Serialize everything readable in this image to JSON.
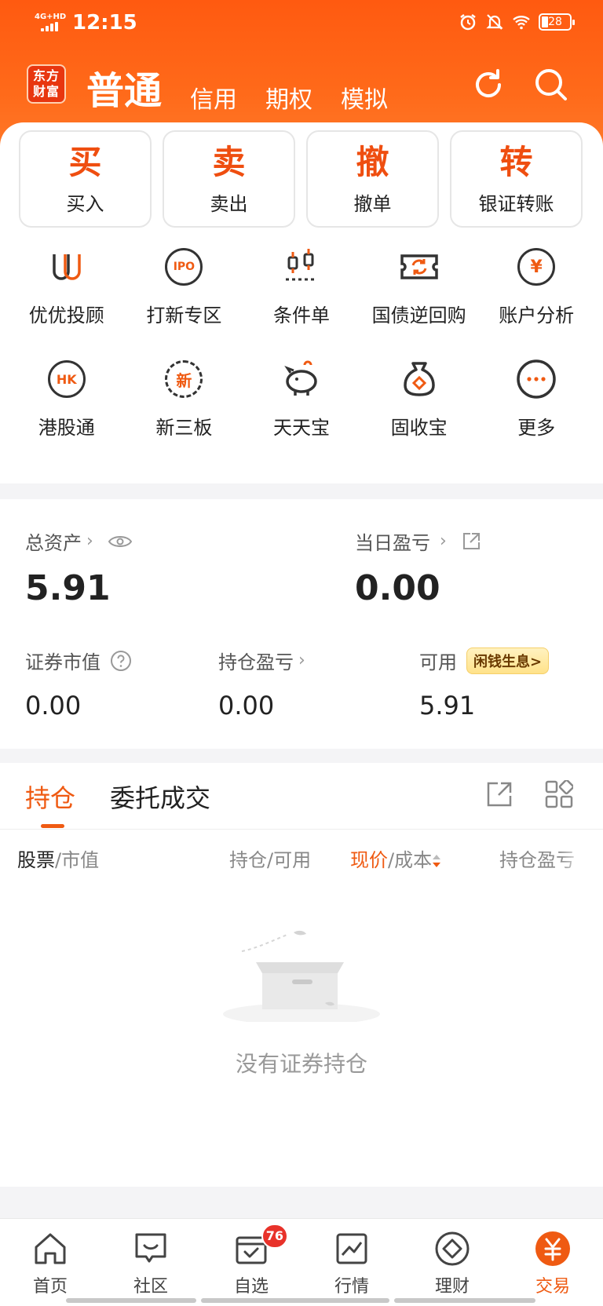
{
  "status_bar": {
    "network": "4G+HD",
    "time": "12:15",
    "battery": "28"
  },
  "header": {
    "logo_line1": "东方",
    "logo_line2": "财富",
    "account_tabs": [
      "普通",
      "信用",
      "期权",
      "模拟"
    ]
  },
  "trade_buttons": [
    {
      "icon": "买",
      "label": "买入"
    },
    {
      "icon": "卖",
      "label": "卖出"
    },
    {
      "icon": "撤",
      "label": "撤单"
    },
    {
      "icon": "转",
      "label": "银证转账"
    }
  ],
  "features": [
    {
      "label": "优优投顾",
      "icon": "uu-advisor-icon"
    },
    {
      "label": "打新专区",
      "icon": "ipo-icon"
    },
    {
      "label": "条件单",
      "icon": "condition-order-icon"
    },
    {
      "label": "国债逆回购",
      "icon": "repo-icon"
    },
    {
      "label": "账户分析",
      "icon": "account-analysis-icon"
    },
    {
      "label": "港股通",
      "icon": "hk-connect-icon"
    },
    {
      "label": "新三板",
      "icon": "neeq-icon"
    },
    {
      "label": "天天宝",
      "icon": "piggy-bank-icon"
    },
    {
      "label": "固收宝",
      "icon": "money-bag-icon"
    },
    {
      "label": "更多",
      "icon": "more-icon"
    }
  ],
  "feature_icon_text": {
    "ipo": "IPO",
    "hk": "HK",
    "neeq": "新",
    "yuan": "¥"
  },
  "assets": {
    "total_label": "总资产",
    "total_value": "5.91",
    "daily_pl_label": "当日盈亏",
    "daily_pl_value": "0.00",
    "market_value_label": "证券市值",
    "market_value": "0.00",
    "position_pl_label": "持仓盈亏",
    "position_pl_value": "0.00",
    "available_label": "可用",
    "available_value": "5.91",
    "idle_cash_badge": "闲钱生息>"
  },
  "positions": {
    "tabs": [
      "持仓",
      "委托成交"
    ],
    "columns": {
      "stock": "股票",
      "market_value": "/市值",
      "holding": "持仓/可用",
      "price": "现价",
      "cost": "/成本",
      "pl": "持仓盈亏"
    },
    "empty_text": "没有证券持仓"
  },
  "bottom_nav": [
    {
      "label": "首页",
      "icon": "home-icon"
    },
    {
      "label": "社区",
      "icon": "community-icon"
    },
    {
      "label": "自选",
      "icon": "watchlist-icon",
      "badge": "76"
    },
    {
      "label": "行情",
      "icon": "market-icon"
    },
    {
      "label": "理财",
      "icon": "wealth-icon"
    },
    {
      "label": "交易",
      "icon": "trade-icon",
      "active": true
    }
  ],
  "colors": {
    "brand": "#ff5a10",
    "accent": "#ef5a12",
    "badge": "#e8322a"
  }
}
